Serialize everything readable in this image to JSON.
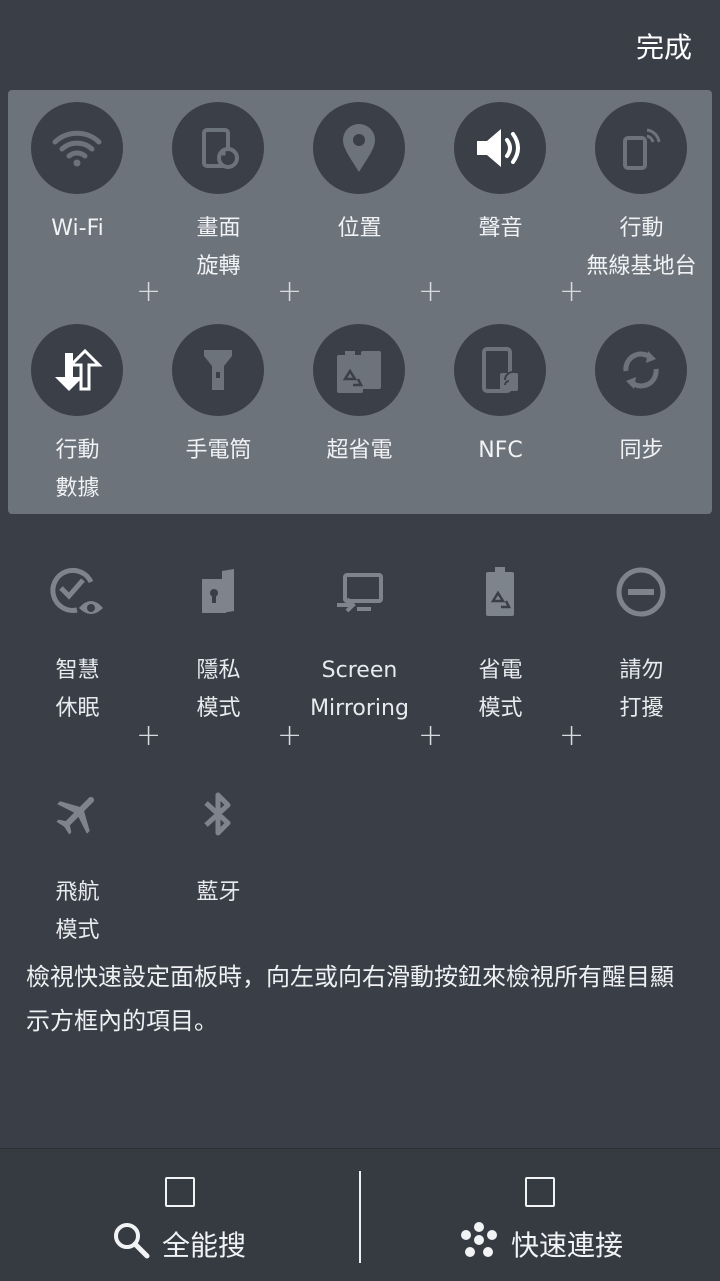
{
  "header": {
    "done_label": "完成"
  },
  "active_tiles": [
    {
      "label": "Wi-Fi",
      "icon": "wifi-icon"
    },
    {
      "label": "畫面\n旋轉",
      "icon": "rotate-screen-icon"
    },
    {
      "label": "位置",
      "icon": "location-icon"
    },
    {
      "label": "聲音",
      "icon": "volume-icon"
    },
    {
      "label": "行動\n無線基地台",
      "icon": "hotspot-icon"
    },
    {
      "label": "行動\n數據",
      "icon": "mobile-data-icon"
    },
    {
      "label": "手電筒",
      "icon": "flashlight-icon"
    },
    {
      "label": "超省電",
      "icon": "super-power-saving-icon"
    },
    {
      "label": "NFC",
      "icon": "nfc-icon"
    },
    {
      "label": "同步",
      "icon": "sync-icon"
    }
  ],
  "inactive_tiles": [
    {
      "label": "智慧\n休眠",
      "icon": "smart-stay-icon"
    },
    {
      "label": "隱私\n模式",
      "icon": "private-mode-icon"
    },
    {
      "label": "Screen\nMirroring",
      "icon": "screen-mirroring-icon"
    },
    {
      "label": "省電\n模式",
      "icon": "power-saving-icon"
    },
    {
      "label": "請勿\n打擾",
      "icon": "do-not-disturb-icon"
    },
    {
      "label": "飛航\n模式",
      "icon": "airplane-icon"
    },
    {
      "label": "藍牙",
      "icon": "bluetooth-icon"
    }
  ],
  "description": "檢視快速設定面板時，向左或向右滑動按鈕來檢視所有醒目顯示方框內的項目。",
  "bottom": {
    "left_label": "全能搜",
    "right_label": "快速連接"
  },
  "colors": {
    "background": "#3a3f47",
    "panel": "#6c737b",
    "tile_circle": "#3b4048",
    "inactive_icon": "#7d848c"
  }
}
